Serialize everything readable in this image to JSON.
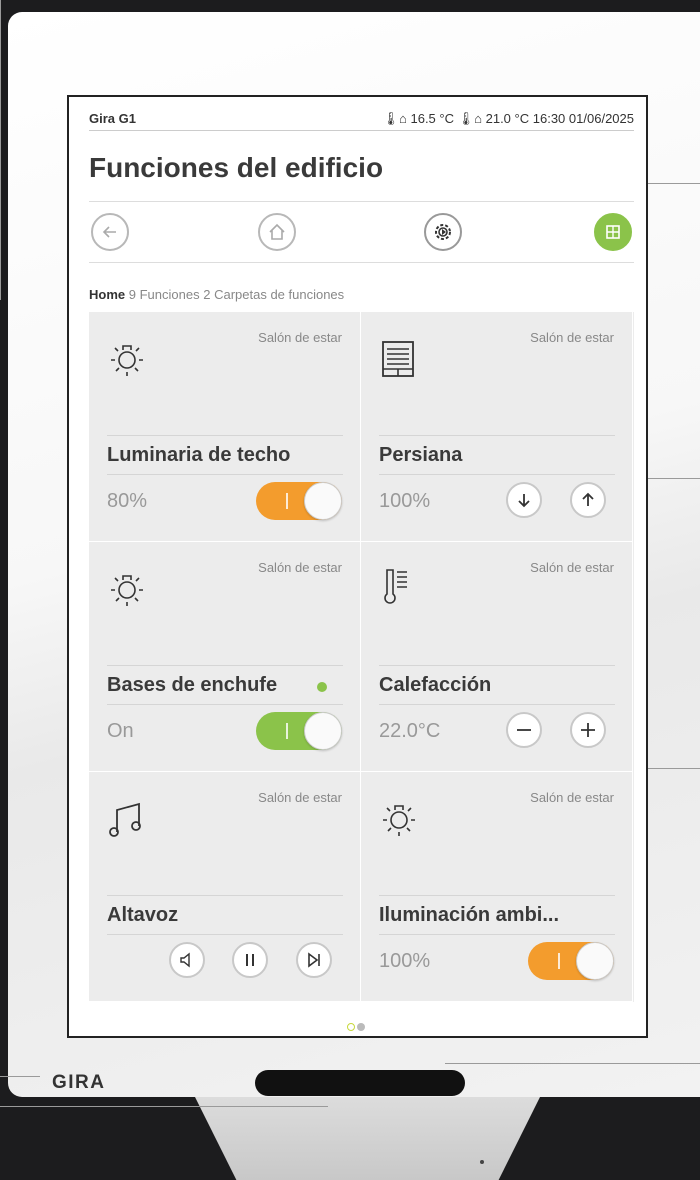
{
  "device": {
    "brand": "GIRA"
  },
  "statusbar": {
    "title": "Gira G1",
    "outdoor_temp": "16.5 °C",
    "indoor_temp": "21.0 °C",
    "time": "16:30",
    "date": "01/06/2025"
  },
  "page_title": "Funciones del edificio",
  "toolbar": {
    "back_icon": "arrow-left-icon",
    "home_icon": "house-icon",
    "settings_icon": "gear-icon",
    "grid_icon": "grid-icon",
    "active_color": "#8bc34a"
  },
  "breadcrumb": {
    "home": "Home",
    "functions_count": "9",
    "functions_label": "Funciones",
    "folders_count": "2",
    "folders_label": "Carpetas de funciones"
  },
  "tiles": [
    {
      "room": "Salón de estar",
      "name": "Luminaria de techo",
      "value": "80%",
      "icon": "light-bulb-icon",
      "control": "toggle",
      "toggle_color": "#f39c2d"
    },
    {
      "room": "Salón de estar",
      "name": "Persiana",
      "value": "100%",
      "icon": "blind-icon",
      "control": "updown"
    },
    {
      "room": "Salón de estar",
      "name": "Bases de enchufe",
      "value": "On",
      "icon": "light-bulb-icon",
      "control": "toggle",
      "toggle_color": "#8bc34a",
      "status_led": "#8bc34a"
    },
    {
      "room": "Salón de estar",
      "name": "Calefacción",
      "value": "22.0°C",
      "icon": "thermometer-icon",
      "control": "minusplus"
    },
    {
      "room": "Salón de estar",
      "name": "Altavoz",
      "value": "",
      "icon": "music-note-icon",
      "control": "media"
    },
    {
      "room": "Salón de estar",
      "name": "Iluminación ambi...",
      "value": "100%",
      "icon": "light-bulb-icon",
      "control": "toggle",
      "toggle_color": "#f39c2d"
    }
  ],
  "pager": {
    "pages": 2,
    "current": 1
  }
}
